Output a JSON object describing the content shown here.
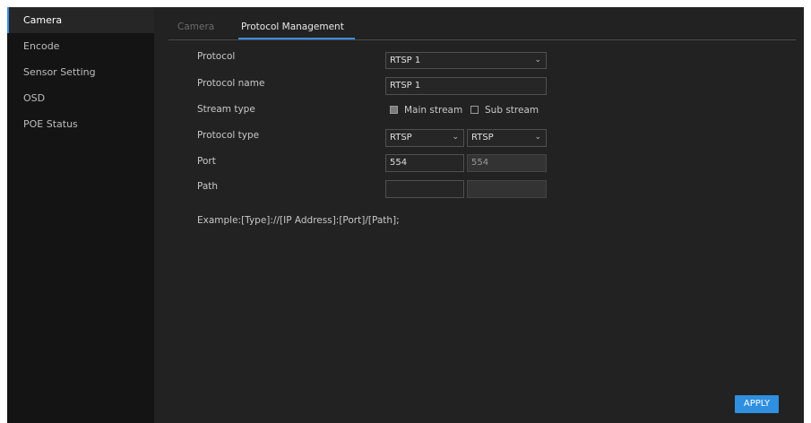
{
  "sidebar": {
    "items": [
      {
        "label": "Camera"
      },
      {
        "label": "Encode"
      },
      {
        "label": "Sensor Setting"
      },
      {
        "label": "OSD"
      },
      {
        "label": "POE Status"
      }
    ]
  },
  "tabs": [
    {
      "label": "Camera"
    },
    {
      "label": "Protocol Management"
    }
  ],
  "form": {
    "protocol": {
      "label": "Protocol",
      "value": "RTSP 1"
    },
    "protocol_name": {
      "label": "Protocol name",
      "value": "RTSP 1"
    },
    "stream_type": {
      "label": "Stream type",
      "main": "Main stream",
      "sub": "Sub stream",
      "main_checked": true,
      "sub_checked": false
    },
    "protocol_type": {
      "label": "Protocol type",
      "main_value": "RTSP",
      "sub_value": "RTSP"
    },
    "port": {
      "label": "Port",
      "main_value": "554",
      "sub_value": "554"
    },
    "path": {
      "label": "Path",
      "main_value": "",
      "sub_value": ""
    },
    "example": "Example:[Type]://[IP Address]:[Port]/[Path];"
  },
  "buttons": {
    "apply": "APPLY"
  },
  "colors": {
    "accent": "#2f8fe0",
    "background": "#222222",
    "sidebar": "#141414"
  }
}
